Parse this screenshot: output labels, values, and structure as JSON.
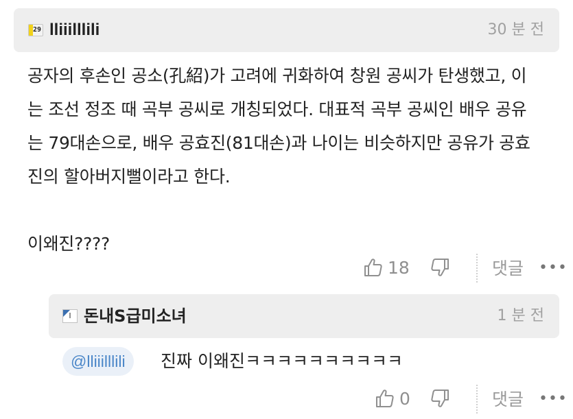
{
  "comment": {
    "badge_level": "29",
    "username": "lliiilllili",
    "timestamp": "30 분 전",
    "body": "공자의 후손인 공소(孔紹)가 고려에 귀화하여 창원 공씨가 탄생했고, 이\n는 조선 정조 때 곡부 공씨로 개칭되었다. 대표적 곡부 공씨인 배우 공유\n는 79대손으로, 배우 공효진(81대손)과 나이는 비슷하지만 공유가 공효\n진의 할아버지뻘이라고 한다.\n\n이왜진????",
    "likes": "18",
    "reply_label": "댓글",
    "more_label": "•••"
  },
  "reply": {
    "badge_level": "I",
    "username": "돈내S급미소녀",
    "timestamp": "1 분 전",
    "mention": "@lliiilllili",
    "text": "진짜 이왜진ㅋㅋㅋㅋㅋㅋㅋㅋㅋㅋ",
    "likes": "0",
    "reply_label": "댓글",
    "more_label": "•••"
  },
  "icons": {
    "like": "thumbs-up-outline-icon",
    "dislike": "thumbs-down-outline-icon",
    "badge_color": "#f2d21a",
    "reply_badge_color": "#3a6fb0"
  }
}
